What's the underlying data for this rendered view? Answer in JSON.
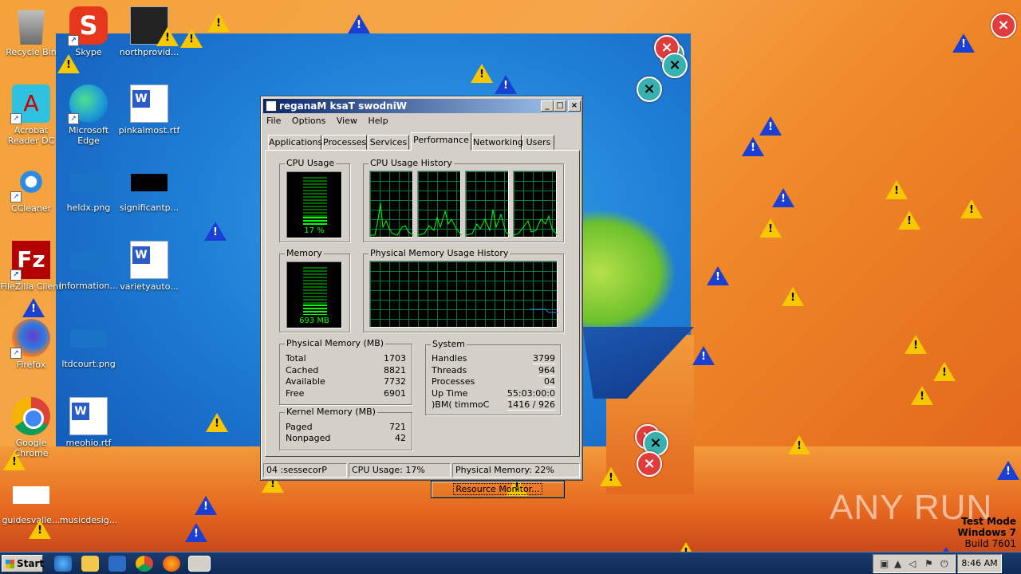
{
  "desktop": {
    "icons": [
      {
        "label": "Recycle Bin",
        "icon": "recycle-bin-icon"
      },
      {
        "label": "Skype",
        "icon": "skype-icon"
      },
      {
        "label": "northprovid...",
        "icon": "file-icon"
      },
      {
        "label": "Acrobat Reader DC",
        "icon": "acrobat-icon"
      },
      {
        "label": "Microsoft Edge",
        "icon": "edge-icon"
      },
      {
        "label": "pinkalmost.rtf",
        "icon": "word-doc-icon"
      },
      {
        "label": "CCleaner",
        "icon": "ccleaner-icon"
      },
      {
        "label": "heldx.png",
        "icon": "image-icon"
      },
      {
        "label": "significantp...",
        "icon": "image-icon"
      },
      {
        "label": "FileZilla Client",
        "icon": "filezilla-icon"
      },
      {
        "label": "information...",
        "icon": "image-icon"
      },
      {
        "label": "varietyauto...",
        "icon": "word-doc-icon"
      },
      {
        "label": "Firefox",
        "icon": "firefox-icon"
      },
      {
        "label": "ltdcourt.png",
        "icon": "image-icon"
      },
      {
        "label": "Google Chrome",
        "icon": "chrome-icon"
      },
      {
        "label": "meohio.rtf",
        "icon": "word-doc-icon"
      },
      {
        "label": "guidesvalle...",
        "icon": "image-icon"
      },
      {
        "label": "musicdesig...",
        "icon": "image-icon"
      }
    ]
  },
  "taskmgr": {
    "title": "reganaM ksaT swodniW",
    "menu": [
      "File",
      "Options",
      "View",
      "Help"
    ],
    "tabs": [
      "Applications",
      "Processes",
      "Services",
      "Performance",
      "Networking",
      "Users"
    ],
    "active_tab": "Performance",
    "cpu_usage": {
      "label": "CPU Usage",
      "value_text": "17 %",
      "percent": 17
    },
    "cpu_history": {
      "label": "CPU Usage History"
    },
    "memory": {
      "label": "Memory",
      "value_text": "693 MB",
      "percent": 22
    },
    "mem_history": {
      "label": "Physical Memory Usage History"
    },
    "physical_memory": {
      "label": "Physical Memory (MB)",
      "rows": [
        {
          "k": "Total",
          "v": "1703"
        },
        {
          "k": "Cached",
          "v": "8821"
        },
        {
          "k": "Available",
          "v": "7732"
        },
        {
          "k": "Free",
          "v": "6901"
        }
      ]
    },
    "kernel_memory": {
      "label": "Kernel Memory (MB)",
      "rows": [
        {
          "k": "Paged",
          "v": "721"
        },
        {
          "k": "Nonpaged",
          "v": "42"
        }
      ]
    },
    "system": {
      "label": "System",
      "rows": [
        {
          "k": "Handles",
          "v": "3799"
        },
        {
          "k": "Threads",
          "v": "964"
        },
        {
          "k": "Processes",
          "v": "04"
        },
        {
          "k": "Up Time",
          "v": "55:03:00:0"
        },
        {
          "k": ")BM( timmoC",
          "v": "1416 / 926"
        }
      ]
    },
    "resource_monitor_button": "Resource Monitor...",
    "status": {
      "processes": "04 :sessecorP",
      "cpu": "CPU Usage: 17%",
      "memory": "Physical Memory: 22%"
    }
  },
  "taskbar": {
    "start_label": "Start",
    "clock": "8:46 AM"
  },
  "watermark": "ANY RUN",
  "test_mode": {
    "line1": "Test Mode",
    "line2": "Windows 7",
    "line3": "Build 7601"
  },
  "colors": {
    "accent": "#0a246a",
    "graph_green": "#00ff00",
    "error_red": "#e03c3c",
    "warning_yellow": "#f7c800"
  }
}
